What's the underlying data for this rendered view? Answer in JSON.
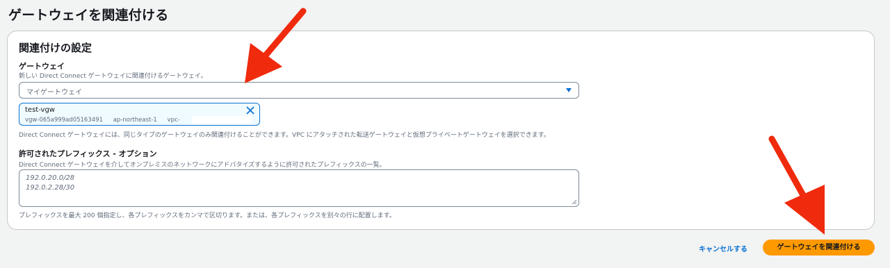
{
  "page": {
    "title": "ゲートウェイを関連付ける"
  },
  "section": {
    "title": "関連付けの設定"
  },
  "gateway": {
    "label": "ゲートウェイ",
    "description": "新しい Direct Connect ゲートウェイに関連付けるゲートウェイ。",
    "select_value": "マイゲートウェイ",
    "selected_token": {
      "name": "test-vgw",
      "id": "vgw-065a999ad05163491",
      "region": "ap-northeast-1",
      "vpc": "vpc-"
    },
    "help": "Direct Connect ゲートウェイには、同じタイプのゲートウェイのみ関連付けることができます。VPC にアタッチされた転送ゲートウェイと仮想プライベートゲートウェイを選択できます。"
  },
  "prefixes": {
    "label": "許可されたプレフィックス - オプション",
    "description": "Direct Connect ゲートウェイを介してオンプレミスのネットワークにアドバタイズするように許可されたプレフィックスの一覧。",
    "lines": [
      "192.0.20.0/28",
      "192.0.2.28/30"
    ],
    "help": "プレフィックスを最大 200 個指定し、各プレフィックスをカンマで区切ります。または、各プレフィックスを別々の行に配置します。"
  },
  "actions": {
    "cancel_label": "キャンセルする",
    "submit_label": "ゲートウェイを関連付ける"
  },
  "colors": {
    "accent": "#0972d3",
    "primary_button": "#ff9900",
    "annotation_arrow": "#f02a0c"
  },
  "icons": {
    "select_caret": "caret-down-icon",
    "token_remove": "close-icon",
    "annotation": "arrow-annotation-icon"
  }
}
